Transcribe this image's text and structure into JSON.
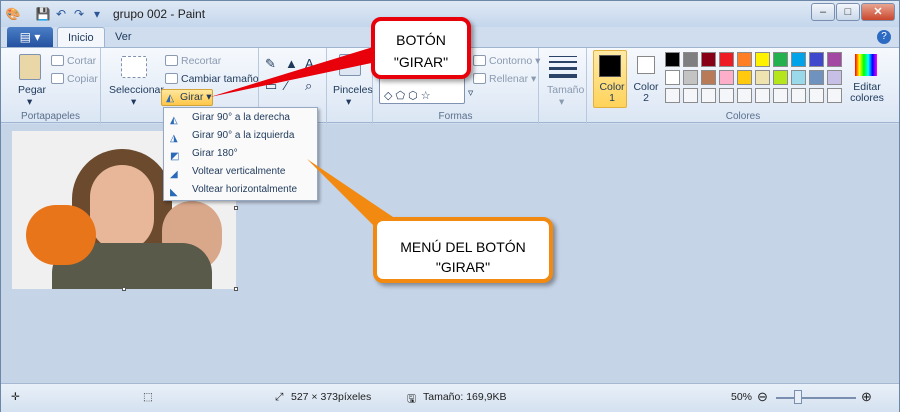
{
  "window": {
    "title": "grupo 002 - Paint"
  },
  "tabs": {
    "file": "▤ ▾",
    "home": "Inicio",
    "view": "Ver"
  },
  "ribbon": {
    "clipboard": {
      "paste": "Pegar",
      "cut": "Cortar",
      "copy": "Copiar",
      "label": "Portapapeles"
    },
    "image": {
      "select": "Seleccionar",
      "crop": "Recortar",
      "resize": "Cambiar tamaño",
      "rotate": "Girar"
    },
    "tools": {
      "brushes": "Pinceles"
    },
    "shapes": {
      "outline": "Contorno",
      "fill": "Rellenar",
      "label": "Formas"
    },
    "size": {
      "label": "Tamaño"
    },
    "colors": {
      "color1": "Color 1",
      "color2": "Color 2",
      "edit": "Editar colores",
      "label": "Colores",
      "row1": [
        "#000000",
        "#7f7f7f",
        "#880015",
        "#ed1c24",
        "#ff7f27",
        "#fff200",
        "#22b14c",
        "#00a2e8",
        "#3f48cc",
        "#a349a4"
      ],
      "row2": [
        "#ffffff",
        "#c3c3c3",
        "#b97a57",
        "#ffaec9",
        "#ffc90e",
        "#efe4b0",
        "#b5e61d",
        "#99d9ea",
        "#7092be",
        "#c8bfe7"
      ]
    }
  },
  "rotate_menu": {
    "items": [
      "Girar 90° a la derecha",
      "Girar 90° a la izquierda",
      "Girar 180°",
      "Voltear verticalmente",
      "Voltear horizontalmente"
    ]
  },
  "status": {
    "dimensions": "527 × 373píxeles",
    "size": "Tamaño: 169,9KB",
    "zoom": "50%"
  },
  "callouts": {
    "button": "BOTÓN \"GIRAR\"",
    "menu": "MENÚ DEL BOTÓN \"GIRAR\""
  }
}
